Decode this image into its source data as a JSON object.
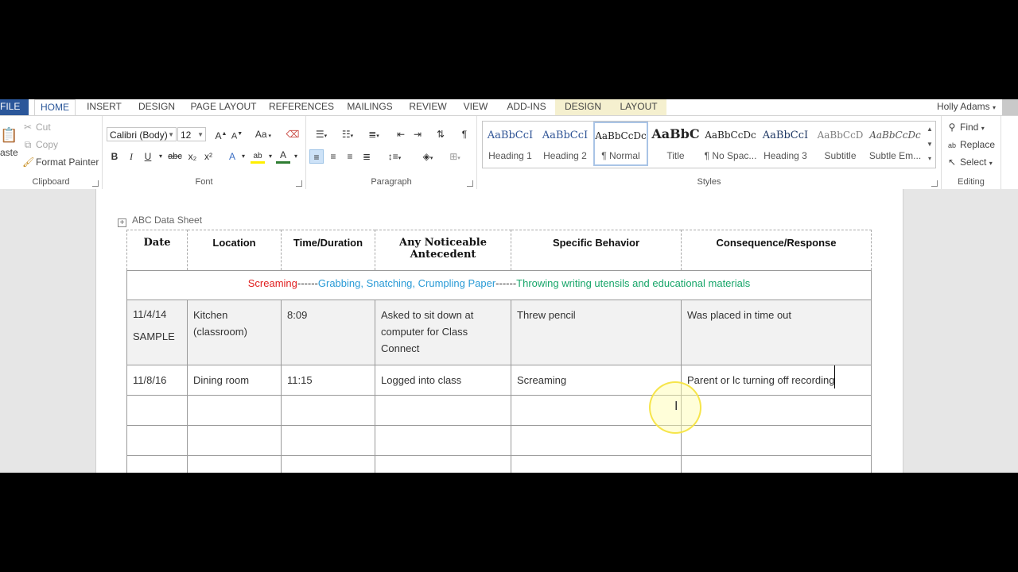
{
  "tabs": [
    {
      "label": "FILE"
    },
    {
      "label": "HOME"
    },
    {
      "label": "INSERT"
    },
    {
      "label": "DESIGN"
    },
    {
      "label": "PAGE LAYOUT"
    },
    {
      "label": "REFERENCES"
    },
    {
      "label": "MAILINGS"
    },
    {
      "label": "REVIEW"
    },
    {
      "label": "VIEW"
    },
    {
      "label": "ADD-INS"
    },
    {
      "label": "DESIGN"
    },
    {
      "label": "LAYOUT"
    }
  ],
  "user": {
    "name": "Holly Adams"
  },
  "ribbon": {
    "clipboard": {
      "label": "Clipboard",
      "paste": "aste",
      "cut": "Cut",
      "copy": "Copy",
      "format_painter": "Format Painter"
    },
    "font": {
      "label": "Font",
      "family": "Calibri (Body)",
      "size": "12",
      "grow": "A",
      "shrink": "A",
      "case": "Aa",
      "bold": "B",
      "italic": "I",
      "underline": "U",
      "strike": "abc",
      "sub": "x₂",
      "sup": "x²",
      "effects": "A",
      "highlight": "ab",
      "color": "A"
    },
    "paragraph": {
      "label": "Paragraph",
      "pilcrow": "¶"
    },
    "styles": {
      "label": "Styles",
      "items": [
        {
          "preview": "AaBbCcI",
          "name": "Heading 1"
        },
        {
          "preview": "AaBbCcI",
          "name": "Heading 2"
        },
        {
          "preview": "AaBbCcDc",
          "name": "¶ Normal"
        },
        {
          "preview": "AaBbC",
          "name": "Title"
        },
        {
          "preview": "AaBbCcDc",
          "name": "¶ No Spac..."
        },
        {
          "preview": "AaBbCcI",
          "name": "Heading 3"
        },
        {
          "preview": "AaBbCcD",
          "name": "Subtitle"
        },
        {
          "preview": "AaBbCcDc",
          "name": "Subtle Em..."
        }
      ]
    },
    "editing": {
      "label": "Editing",
      "find": "Find",
      "replace": "Replace",
      "select": "Select"
    }
  },
  "document": {
    "title": "ABC Data Sheet",
    "table": {
      "headers": [
        "Date",
        "Location",
        "Time/Duration",
        "Any Noticeable Antecedent",
        "Specific Behavior",
        "Consequence/Response"
      ],
      "banner": {
        "part1": "Screaming",
        "sep1": "------",
        "part2": "Grabbing, Snatching, Crumpling Paper",
        "sep2": "------",
        "part3": "Throwing writing utensils and educational materials"
      },
      "rows": [
        {
          "date": "11/4/14",
          "date2": "SAMPLE",
          "location": "Kitchen (classroom)",
          "time": "8:09",
          "antecedent": "Asked to sit down at computer for Class Connect",
          "behavior": "Threw pencil",
          "consequence": "Was placed in time out"
        },
        {
          "date": "11/8/16",
          "location": "Dining room",
          "time": "11:15",
          "antecedent": "Logged into class",
          "behavior": "Screaming",
          "consequence": "Parent or lc turning off recording"
        }
      ]
    }
  },
  "colors": {
    "file_tab": "#2b579a",
    "accent_red": "#e02020",
    "accent_blue": "#2a9bd6",
    "accent_green": "#18a66a"
  }
}
